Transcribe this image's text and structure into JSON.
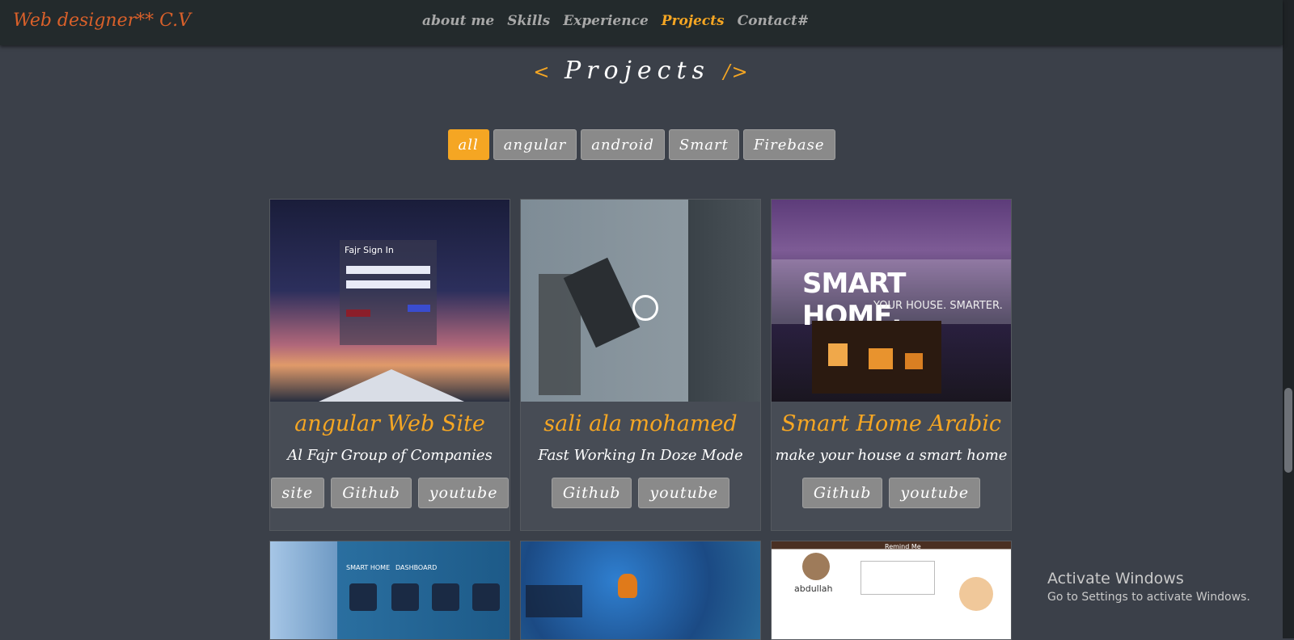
{
  "navbar": {
    "brand": "Web designer** C.V",
    "links": [
      "about me",
      "Skills",
      "Experience",
      "Projects",
      "Contact#"
    ]
  },
  "section": {
    "open": "<",
    "title": "Projects",
    "close": "/>"
  },
  "filters": [
    "all",
    "angular",
    "android",
    "Smart",
    "Firebase"
  ],
  "projects": [
    {
      "title": "angular Web Site",
      "desc": "Al Fajr Group of Companies",
      "buttons": [
        "site",
        "Github",
        "youtube"
      ],
      "image_text": "Fajr Sign In"
    },
    {
      "title": "sali ala mohamed",
      "desc": "Fast Working In Doze Mode",
      "buttons": [
        "Github",
        "youtube"
      ]
    },
    {
      "title": "Smart Home Arabic",
      "desc": "make your house a smart home",
      "buttons": [
        "Github",
        "youtube"
      ],
      "image_text": "SMART HOME.",
      "image_sub": "YOUR HOUSE. SMARTER."
    }
  ],
  "more_projects_labels": {
    "smart_home_header": "SMART HOME",
    "dashboard": "DASHBOARD",
    "remind": "Remind Me",
    "user": "abdullah"
  },
  "watermark": {
    "line1": "Activate Windows",
    "line2": "Go to Settings to activate Windows."
  }
}
